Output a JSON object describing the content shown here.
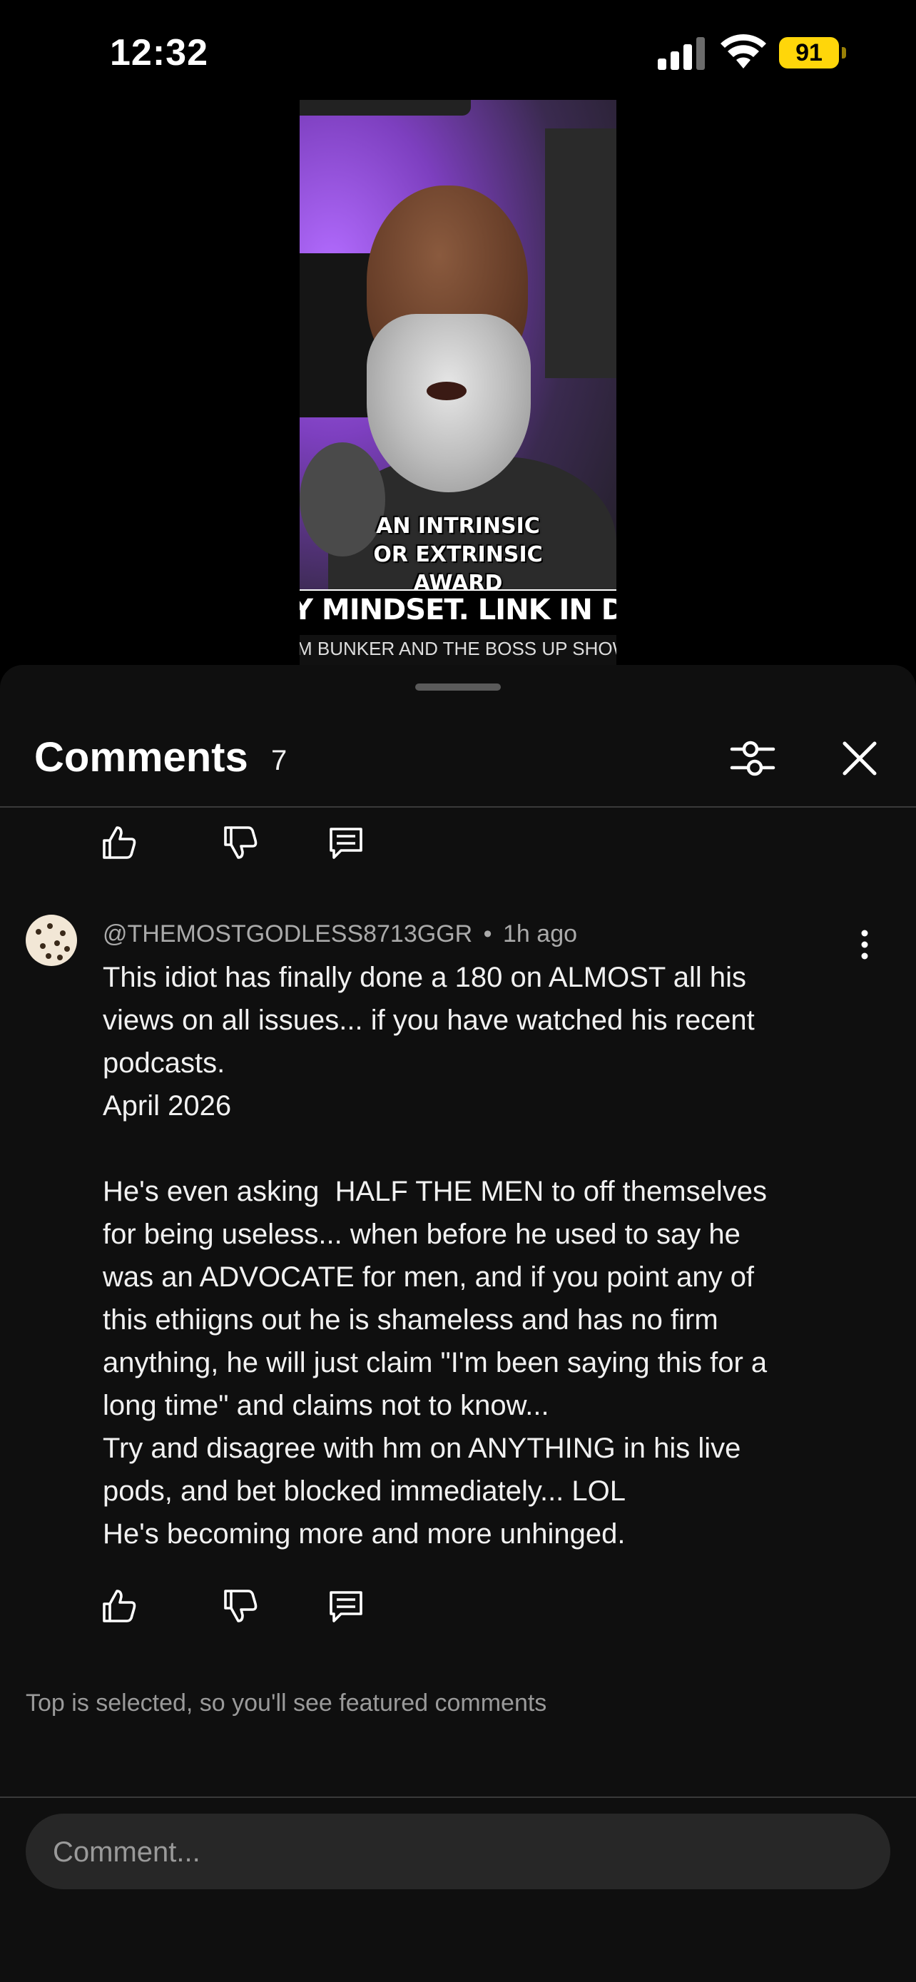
{
  "status_bar": {
    "time": "12:32",
    "battery": "91"
  },
  "video": {
    "caption_lines": [
      "AN INTRINSIC",
      "OR EXTRINSIC",
      "AWARD"
    ],
    "title_overlay": "Y MINDSET. LINK IN DESCRIPTION",
    "subtitle_overlay": "M BUNKER AND THE BOSS UP SHOW"
  },
  "comments_panel": {
    "title": "Comments",
    "count": "7",
    "comments": [
      {
        "author": "@THEMOSTGODLESS8713GGR",
        "separator": "•",
        "time": "1h ago",
        "lines": [
          "This idiot has finally done a 180 on ALMOST all his",
          "views on all issues... if you have watched his recent",
          "podcasts.",
          "April 2026",
          "",
          "He's even asking  HALF THE MEN to off themselves",
          "for being useless... when before he used to say he",
          "was an ADVOCATE for men, and if you point any of",
          "this ethiigns out he is shameless and has no firm",
          "anything, he will just claim \"I'm been saying this for a",
          "long time\" and claims not to know...",
          "Try and disagree with hm on ANYTHING in his live",
          "pods, and bet blocked immediately... LOL",
          "He's becoming more and more unhinged."
        ]
      }
    ],
    "footer_note": "Top is selected, so you'll see featured comments",
    "composer_placeholder": "Comment..."
  },
  "icons": {
    "like": "thumbs-up-icon",
    "dislike": "thumbs-down-icon",
    "reply": "reply-bubble-icon",
    "filter": "sliders-icon",
    "close": "close-icon",
    "more": "kebab-menu-icon"
  }
}
